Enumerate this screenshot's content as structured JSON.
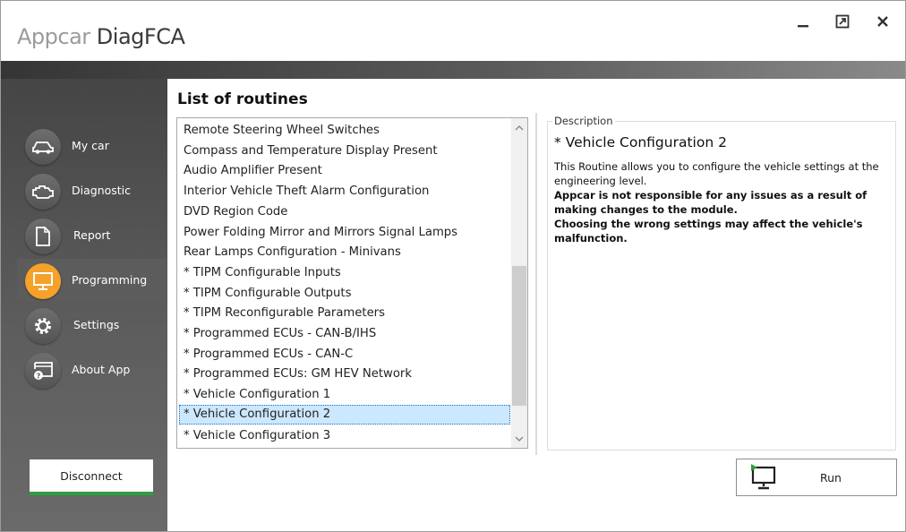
{
  "app": {
    "title_light": "Appcar ",
    "title_dark": "DiagFCA"
  },
  "window_controls": [
    "minimize-icon",
    "maximize-icon",
    "close-icon"
  ],
  "sidebar": {
    "items": [
      {
        "label": "My car",
        "icon": "car-icon",
        "active": false
      },
      {
        "label": "Diagnostic",
        "icon": "engine-icon",
        "active": false
      },
      {
        "label": "Report",
        "icon": "document-icon",
        "active": false
      },
      {
        "label": "Programming",
        "icon": "monitor-icon",
        "active": true
      },
      {
        "label": "Settings",
        "icon": "gear-icon",
        "active": false
      },
      {
        "label": "About App",
        "icon": "info-window-icon",
        "active": false
      }
    ],
    "disconnect_label": "Disconnect"
  },
  "main": {
    "title": "List of routines",
    "routines": [
      "Remote Steering Wheel Switches",
      "Compass and Temperature Display Present",
      "Audio Amplifier Present",
      "Interior Vehicle Theft Alarm Configuration",
      "DVD Region Code",
      "Power Folding Mirror and Mirrors Signal Lamps",
      "Rear Lamps Configuration - Minivans",
      "* TIPM Configurable Inputs",
      "* TIPM Configurable Outputs",
      "* TIPM Reconfigurable Parameters",
      "* Programmed ECUs - CAN-B/IHS",
      "* Programmed ECUs - CAN-C",
      "* Programmed ECUs: GM HEV Network",
      "* Vehicle Configuration 1",
      "* Vehicle Configuration 2",
      "* Vehicle Configuration 3"
    ],
    "selected_index": 14,
    "description": {
      "legend": "Description",
      "title": "* Vehicle Configuration 2",
      "text": "This Routine allows you to configure the vehicle settings at the engineering level.",
      "warning_1": "Appcar is not responsible for any issues as a result of making changes to the module.",
      "warning_2": "Choosing the wrong settings may affect the vehicle's malfunction."
    },
    "run_label": "Run"
  },
  "colors": {
    "accent_orange": "#f5a12a",
    "connect_green": "#2f9e3e",
    "selection": "#cce8ff"
  }
}
